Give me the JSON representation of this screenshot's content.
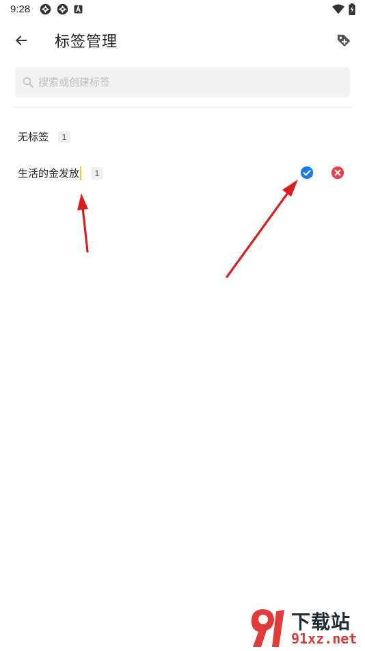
{
  "status_bar": {
    "time": "9:28",
    "left_icons": [
      "aperture-icon",
      "aperture-icon",
      "a-badge-icon"
    ],
    "right_icons": [
      "wifi-icon",
      "battery-charging-icon"
    ]
  },
  "app_bar": {
    "title": "标签管理",
    "back_icon": "arrow-left-icon",
    "action_icon": "tag-add-icon"
  },
  "search": {
    "placeholder": "搜索或创建标签",
    "value": ""
  },
  "tags": [
    {
      "name": "无标签",
      "count": "1"
    },
    {
      "name": "生活的金发放",
      "count": "1",
      "editing": true
    }
  ],
  "colors": {
    "accent": "#1e7be6",
    "danger": "#e5404a",
    "caret": "#f5c518",
    "annotation_arrow": "#d81e1e"
  },
  "watermark": {
    "brand": "91",
    "title": "下载站",
    "url": "91xz.net"
  }
}
